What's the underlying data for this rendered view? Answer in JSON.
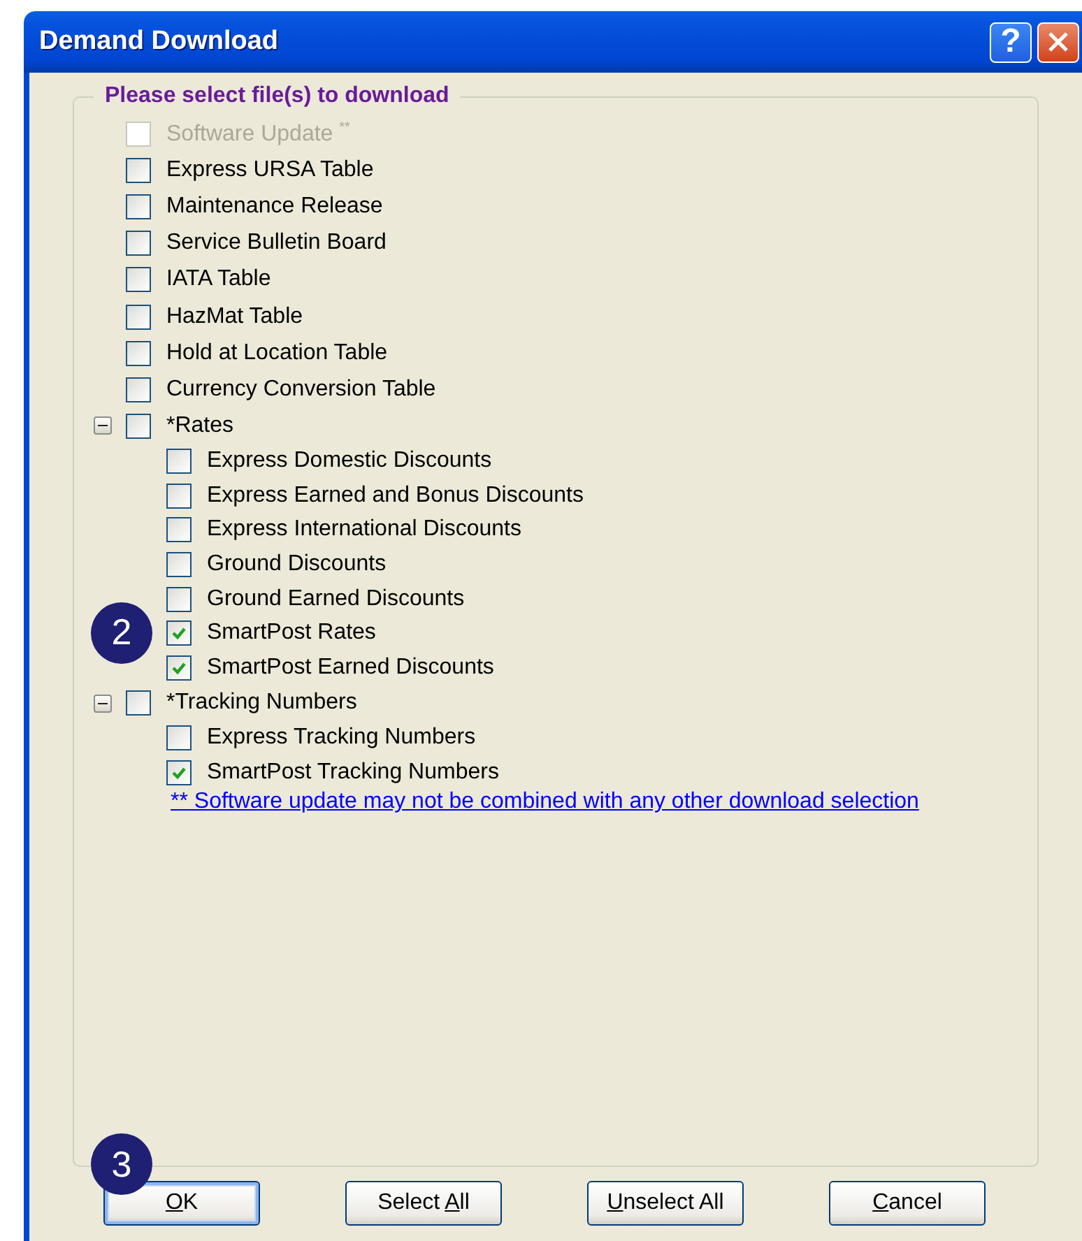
{
  "window": {
    "title": "Demand Download",
    "help_button": "?"
  },
  "group": {
    "legend": "Please select file(s) to download",
    "items": [
      {
        "label": "Software Update $^{**}$",
        "checked": false,
        "disabled": true
      },
      {
        "label": "Express URSA Table",
        "checked": false,
        "disabled": false
      },
      {
        "label": "Maintenance Release",
        "checked": false,
        "disabled": false
      },
      {
        "label": "Service Bulletin Board",
        "checked": false,
        "disabled": false
      },
      {
        "label": "IATA Table",
        "checked": false,
        "disabled": false
      },
      {
        "label": "HazMat Table",
        "checked": false,
        "disabled": false
      },
      {
        "label": "Hold at Location Table",
        "checked": false,
        "disabled": false
      },
      {
        "label": "Currency Conversion Table",
        "checked": false,
        "disabled": false
      },
      {
        "label": "*Rates",
        "checked": false,
        "disabled": false,
        "expanded": true,
        "children": [
          {
            "label": "Express Domestic Discounts",
            "checked": false,
            "disabled": false
          },
          {
            "label": "Express Earned and Bonus Discounts",
            "checked": false,
            "disabled": false
          },
          {
            "label": "Express International Discounts",
            "checked": false,
            "disabled": false
          },
          {
            "label": "Ground Discounts",
            "checked": false,
            "disabled": false
          },
          {
            "label": "Ground Earned Discounts",
            "checked": false,
            "disabled": false
          },
          {
            "label": "SmartPost Rates",
            "checked": true,
            "disabled": false,
            "callout": "2"
          },
          {
            "label": "SmartPost Earned Discounts",
            "checked": true,
            "disabled": false
          }
        ]
      },
      {
        "label": "*Tracking Numbers",
        "checked": false,
        "disabled": false,
        "expanded": true,
        "children": [
          {
            "label": "Express Tracking Numbers",
            "checked": false,
            "disabled": false
          },
          {
            "label": "SmartPost Tracking Numbers",
            "checked": true,
            "disabled": false
          }
        ]
      }
    ],
    "footnote": "** Software update may not be combined with any other download selection"
  },
  "buttons": [
    {
      "access_key": "O",
      "text_after": "K",
      "focused": true,
      "callout": "3"
    },
    {
      "text_before": "Select ",
      "access_key": "A",
      "text_after": "ll",
      "focused": false
    },
    {
      "access_key": "U",
      "text_after": "nselect All",
      "focused": false
    },
    {
      "access_key": "C",
      "text_after": "ancel",
      "focused": false
    }
  ]
}
